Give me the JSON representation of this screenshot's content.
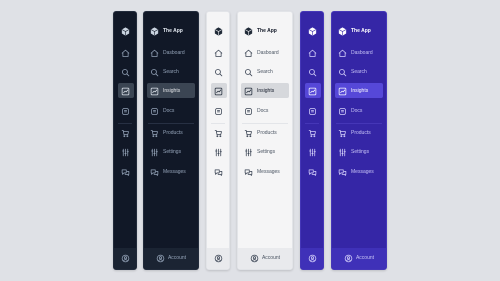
{
  "app": {
    "title": "The App",
    "logo_icon": "cube-icon"
  },
  "nav": {
    "primary": [
      {
        "label": "Dasboard",
        "icon": "home-icon"
      },
      {
        "label": "Search",
        "icon": "search-icon"
      },
      {
        "label": "Insights",
        "icon": "chart-icon",
        "active": true
      },
      {
        "label": "Docs",
        "icon": "docs-icon"
      }
    ],
    "secondary": [
      {
        "label": "Products",
        "icon": "cart-icon"
      },
      {
        "label": "Settings",
        "icon": "sliders-icon"
      },
      {
        "label": "Messages",
        "icon": "messages-icon"
      }
    ]
  },
  "footer": {
    "account_label": "Account",
    "icon": "user-circle-icon"
  },
  "themes": [
    {
      "name": "dark",
      "background": "#111827",
      "active_background": "#3b4553"
    },
    {
      "name": "light",
      "background": "#f5f5f6",
      "active_background": "#d6d8dc"
    },
    {
      "name": "indigo",
      "background": "#3526a6",
      "active_background": "#5648d8"
    }
  ]
}
